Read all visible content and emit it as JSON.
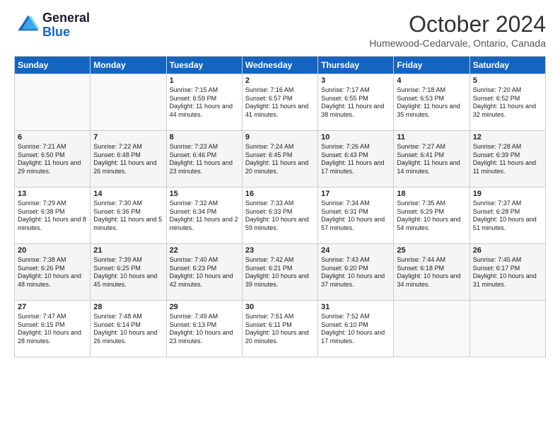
{
  "header": {
    "logo_line1": "General",
    "logo_line2": "Blue",
    "month": "October 2024",
    "location": "Humewood-Cedarvale, Ontario, Canada"
  },
  "days_of_week": [
    "Sunday",
    "Monday",
    "Tuesday",
    "Wednesday",
    "Thursday",
    "Friday",
    "Saturday"
  ],
  "weeks": [
    [
      {
        "day": "",
        "info": ""
      },
      {
        "day": "",
        "info": ""
      },
      {
        "day": "1",
        "info": "Sunrise: 7:15 AM\nSunset: 6:59 PM\nDaylight: 11 hours and 44 minutes."
      },
      {
        "day": "2",
        "info": "Sunrise: 7:16 AM\nSunset: 6:57 PM\nDaylight: 11 hours and 41 minutes."
      },
      {
        "day": "3",
        "info": "Sunrise: 7:17 AM\nSunset: 6:55 PM\nDaylight: 11 hours and 38 minutes."
      },
      {
        "day": "4",
        "info": "Sunrise: 7:18 AM\nSunset: 6:53 PM\nDaylight: 11 hours and 35 minutes."
      },
      {
        "day": "5",
        "info": "Sunrise: 7:20 AM\nSunset: 6:52 PM\nDaylight: 11 hours and 32 minutes."
      }
    ],
    [
      {
        "day": "6",
        "info": "Sunrise: 7:21 AM\nSunset: 6:50 PM\nDaylight: 11 hours and 29 minutes."
      },
      {
        "day": "7",
        "info": "Sunrise: 7:22 AM\nSunset: 6:48 PM\nDaylight: 11 hours and 26 minutes."
      },
      {
        "day": "8",
        "info": "Sunrise: 7:23 AM\nSunset: 6:46 PM\nDaylight: 11 hours and 23 minutes."
      },
      {
        "day": "9",
        "info": "Sunrise: 7:24 AM\nSunset: 6:45 PM\nDaylight: 11 hours and 20 minutes."
      },
      {
        "day": "10",
        "info": "Sunrise: 7:26 AM\nSunset: 6:43 PM\nDaylight: 11 hours and 17 minutes."
      },
      {
        "day": "11",
        "info": "Sunrise: 7:27 AM\nSunset: 6:41 PM\nDaylight: 11 hours and 14 minutes."
      },
      {
        "day": "12",
        "info": "Sunrise: 7:28 AM\nSunset: 6:39 PM\nDaylight: 11 hours and 11 minutes."
      }
    ],
    [
      {
        "day": "13",
        "info": "Sunrise: 7:29 AM\nSunset: 6:38 PM\nDaylight: 11 hours and 8 minutes."
      },
      {
        "day": "14",
        "info": "Sunrise: 7:30 AM\nSunset: 6:36 PM\nDaylight: 11 hours and 5 minutes."
      },
      {
        "day": "15",
        "info": "Sunrise: 7:32 AM\nSunset: 6:34 PM\nDaylight: 11 hours and 2 minutes."
      },
      {
        "day": "16",
        "info": "Sunrise: 7:33 AM\nSunset: 6:33 PM\nDaylight: 10 hours and 59 minutes."
      },
      {
        "day": "17",
        "info": "Sunrise: 7:34 AM\nSunset: 6:31 PM\nDaylight: 10 hours and 57 minutes."
      },
      {
        "day": "18",
        "info": "Sunrise: 7:35 AM\nSunset: 6:29 PM\nDaylight: 10 hours and 54 minutes."
      },
      {
        "day": "19",
        "info": "Sunrise: 7:37 AM\nSunset: 6:28 PM\nDaylight: 10 hours and 51 minutes."
      }
    ],
    [
      {
        "day": "20",
        "info": "Sunrise: 7:38 AM\nSunset: 6:26 PM\nDaylight: 10 hours and 48 minutes."
      },
      {
        "day": "21",
        "info": "Sunrise: 7:39 AM\nSunset: 6:25 PM\nDaylight: 10 hours and 45 minutes."
      },
      {
        "day": "22",
        "info": "Sunrise: 7:40 AM\nSunset: 6:23 PM\nDaylight: 10 hours and 42 minutes."
      },
      {
        "day": "23",
        "info": "Sunrise: 7:42 AM\nSunset: 6:21 PM\nDaylight: 10 hours and 39 minutes."
      },
      {
        "day": "24",
        "info": "Sunrise: 7:43 AM\nSunset: 6:20 PM\nDaylight: 10 hours and 37 minutes."
      },
      {
        "day": "25",
        "info": "Sunrise: 7:44 AM\nSunset: 6:18 PM\nDaylight: 10 hours and 34 minutes."
      },
      {
        "day": "26",
        "info": "Sunrise: 7:45 AM\nSunset: 6:17 PM\nDaylight: 10 hours and 31 minutes."
      }
    ],
    [
      {
        "day": "27",
        "info": "Sunrise: 7:47 AM\nSunset: 6:15 PM\nDaylight: 10 hours and 28 minutes."
      },
      {
        "day": "28",
        "info": "Sunrise: 7:48 AM\nSunset: 6:14 PM\nDaylight: 10 hours and 26 minutes."
      },
      {
        "day": "29",
        "info": "Sunrise: 7:49 AM\nSunset: 6:13 PM\nDaylight: 10 hours and 23 minutes."
      },
      {
        "day": "30",
        "info": "Sunrise: 7:51 AM\nSunset: 6:11 PM\nDaylight: 10 hours and 20 minutes."
      },
      {
        "day": "31",
        "info": "Sunrise: 7:52 AM\nSunset: 6:10 PM\nDaylight: 10 hours and 17 minutes."
      },
      {
        "day": "",
        "info": ""
      },
      {
        "day": "",
        "info": ""
      }
    ]
  ]
}
